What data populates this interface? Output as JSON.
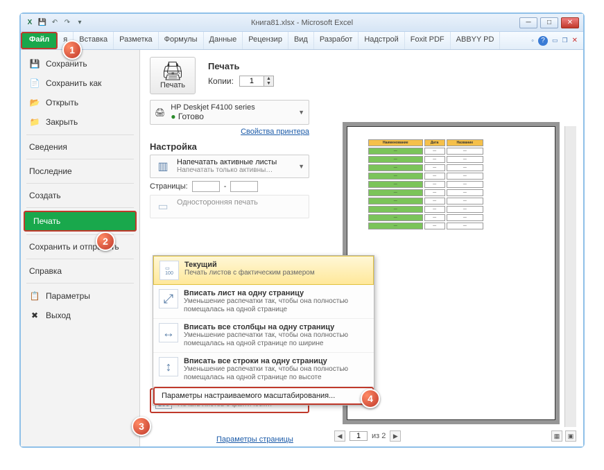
{
  "title": "Книга81.xlsx - Microsoft Excel",
  "qat": {
    "excel": "X",
    "save": "💾",
    "undo": "↶",
    "redo": "↷"
  },
  "ribbon": {
    "file": "Файл",
    "tabs": [
      "я",
      "Вставка",
      "Разметка",
      "Формулы",
      "Данные",
      "Рецензир",
      "Вид",
      "Разработ",
      "Надстрой",
      "Foxit PDF",
      "ABBYY PD"
    ]
  },
  "nav": {
    "save": "Сохранить",
    "saveas": "Сохранить как",
    "open": "Открыть",
    "close": "Закрыть",
    "info": "Сведения",
    "recent": "Последние",
    "new": "Создать",
    "print": "Печать",
    "share": "Сохранить и отправить",
    "help": "Справка",
    "options": "Параметры",
    "exit": "Выход"
  },
  "print": {
    "heading": "Печать",
    "button": "Печать",
    "copies_label": "Копии:",
    "copies": "1",
    "printer_name": "HP Deskjet F4100 series",
    "printer_status": "Готово",
    "printer_props": "Свойства принтера",
    "settings_h": "Настройка",
    "active_t": "Напечатать активные листы",
    "active_s": "Напечатать только активны…",
    "pages_label": "Страницы:",
    "pages_sep": "-",
    "oneside": "Односторонняя печать",
    "scale_t": "Текущий",
    "scale_s": "Печать листов с фактическ…",
    "page_params": "Параметры страницы"
  },
  "dropdown": {
    "o1_t": "Текущий",
    "o1_s": "Печать листов с фактическим размером",
    "o2_t": "Вписать лист на одну страницу",
    "o2_s": "Уменьшение распечатки так, чтобы она полностью помещалась на одной странице",
    "o3_t": "Вписать все столбцы на одну страницу",
    "o3_s": "Уменьшение распечатки так, чтобы она полностью помещалась на одной странице по ширине",
    "o4_t": "Вписать все строки на одну страницу",
    "o4_s": "Уменьшение распечатки так, чтобы она полностью помещалась на одной странице по высоте",
    "foot": "Параметры настраиваемого масштабирования..."
  },
  "footer": {
    "page": "1",
    "of": "из 2"
  },
  "badges": {
    "b1": "1",
    "b2": "2",
    "b3": "3",
    "b4": "4"
  },
  "preview_headers": [
    "Наименование",
    "Дата",
    "Название"
  ]
}
